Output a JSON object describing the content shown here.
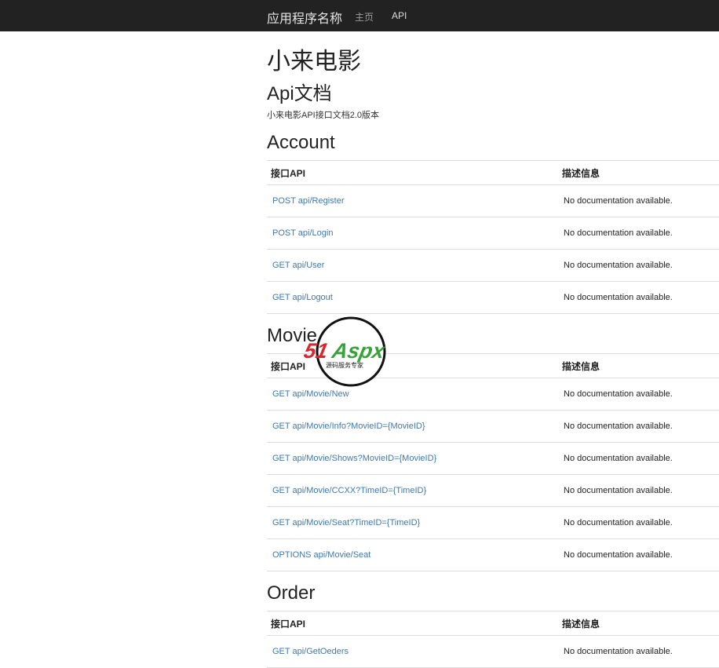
{
  "navbar": {
    "brand": "应用程序名称",
    "links": [
      "主页",
      "API"
    ]
  },
  "page": {
    "title": "小来电影",
    "subtitle": "Api文档",
    "description": "小来电影API接口文档2.0版本"
  },
  "table_headers": {
    "api": "接口API",
    "description": "描述信息"
  },
  "sections": [
    {
      "name": "Account",
      "rows": [
        {
          "api": "POST api/Register",
          "description": "No documentation available."
        },
        {
          "api": "POST api/Login",
          "description": "No documentation available."
        },
        {
          "api": "GET api/User",
          "description": "No documentation available."
        },
        {
          "api": "GET api/Logout",
          "description": "No documentation available."
        }
      ]
    },
    {
      "name": "Movie",
      "rows": [
        {
          "api": "GET api/Movie/New",
          "description": "No documentation available."
        },
        {
          "api": "GET api/Movie/Info?MovieID={MovieID}",
          "description": "No documentation available."
        },
        {
          "api": "GET api/Movie/Shows?MovieID={MovieID}",
          "description": "No documentation available."
        },
        {
          "api": "GET api/Movie/CCXX?TimeID={TimeID}",
          "description": "No documentation available."
        },
        {
          "api": "GET api/Movie/Seat?TimeID={TimeID}",
          "description": "No documentation available."
        },
        {
          "api": "OPTIONS api/Movie/Seat",
          "description": "No documentation available."
        }
      ]
    },
    {
      "name": "Order",
      "rows": [
        {
          "api": "GET api/GetOeders",
          "description": "No documentation available."
        }
      ]
    }
  ],
  "watermark": {
    "logo_text": "51Aspx",
    "tagline": "源码服务专家"
  },
  "colors": {
    "navbar_bg": "#222222",
    "link": "#3d79b0",
    "watermark_red": "#d9262f",
    "watermark_green": "#3aa23a"
  }
}
